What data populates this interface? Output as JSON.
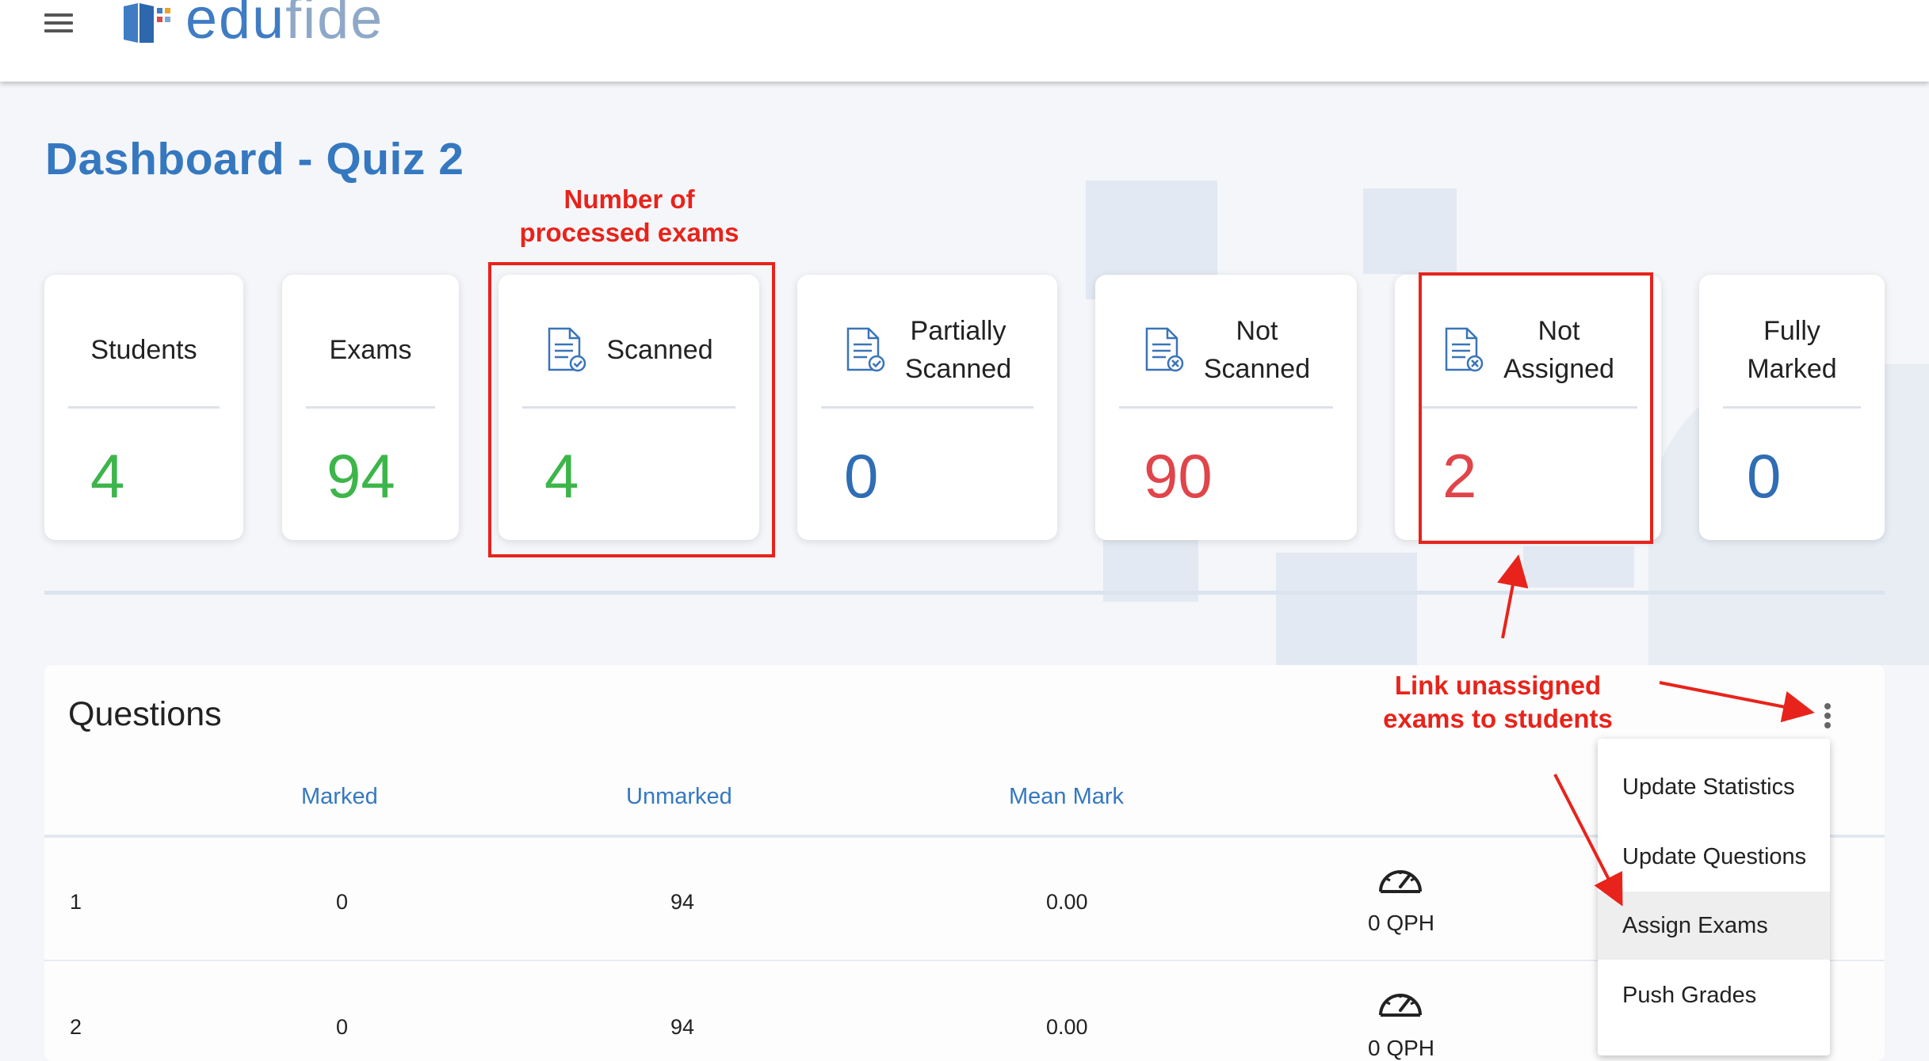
{
  "header": {
    "logo_text_main": "edu",
    "logo_text_light": "fide",
    "brand_color": "#3f7cc4"
  },
  "page": {
    "title": "Dashboard - Quiz 2"
  },
  "stats": [
    {
      "label": "Students",
      "value": "4",
      "color": "#3db54a",
      "icon": ""
    },
    {
      "label": "Exams",
      "value": "94",
      "color": "#3db54a",
      "icon": ""
    },
    {
      "label": "Scanned",
      "value": "4",
      "color": "#3db54a",
      "icon": "document-check-icon"
    },
    {
      "label_line1": "Partially",
      "label_line2": "Scanned",
      "value": "0",
      "color": "#2f6db5",
      "icon": "document-check-icon"
    },
    {
      "label_line1": "Not",
      "label_line2": "Scanned",
      "value": "90",
      "color": "#e0454a",
      "icon": "document-x-icon"
    },
    {
      "label_line1": "Not",
      "label_line2": "Assigned",
      "value": "2",
      "color": "#e0454a",
      "icon": "document-x-icon"
    },
    {
      "label_line1": "Fully",
      "label_line2": "Marked",
      "value": "0",
      "color": "#2f6db5",
      "icon": ""
    }
  ],
  "questions": {
    "title": "Questions",
    "columns": [
      "Marked",
      "Unmarked",
      "Mean Mark"
    ],
    "rows": [
      {
        "number": "1",
        "marked": "0",
        "unmarked": "94",
        "mean": "0.00",
        "rate": "0 QPH"
      },
      {
        "number": "2",
        "marked": "0",
        "unmarked": "94",
        "mean": "0.00",
        "rate": "0 QPH"
      }
    ]
  },
  "menu": {
    "items": [
      "Update Statistics",
      "Update Questions",
      "Assign Exams",
      "Push Grades"
    ],
    "active": "Assign Exams"
  },
  "annotations": {
    "processed_line1": "Number of",
    "processed_line2": "processed exams",
    "link_line1": "Link unassigned",
    "link_line2": "exams to students",
    "color": "#e8231b"
  }
}
